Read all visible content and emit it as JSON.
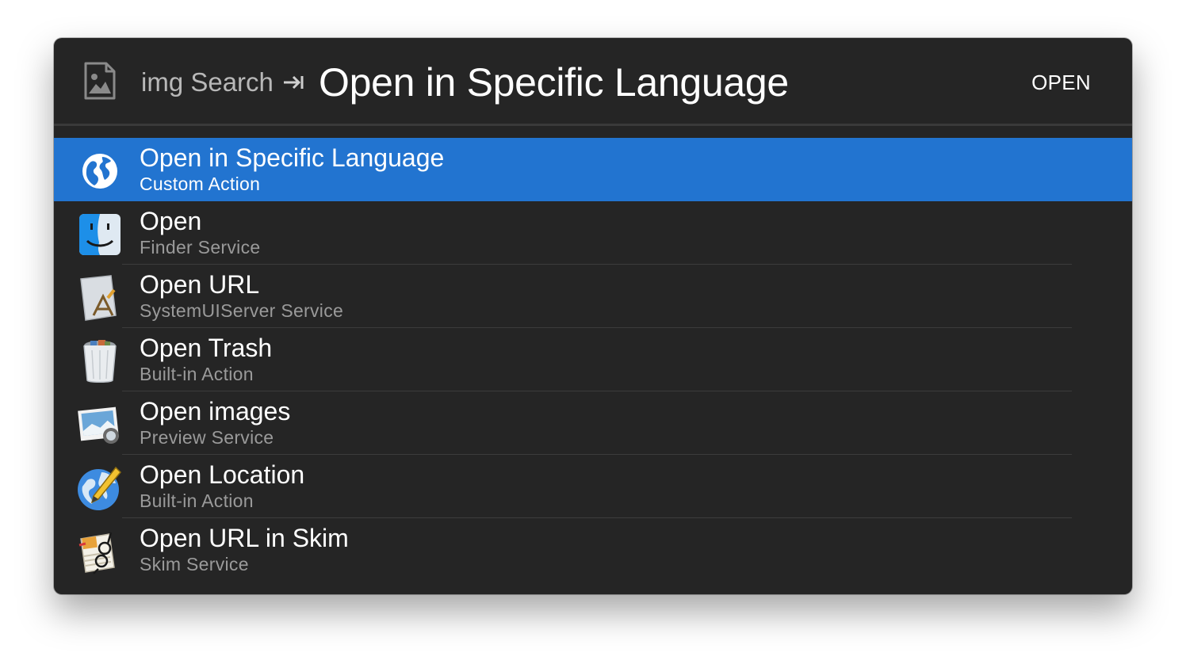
{
  "header": {
    "icon": "image-file-icon",
    "query": "img Search",
    "arrow_icon": "tab-arrow-icon",
    "action_title": "Open in Specific Language",
    "open_label": "OPEN"
  },
  "colors": {
    "window_bg": "#252525",
    "selected_bg": "#2274d0",
    "subtitle": "#9a9a9a"
  },
  "results": [
    {
      "title": "Open in Specific Language",
      "subtitle": "Custom Action",
      "icon": "globe-icon",
      "selected": true
    },
    {
      "title": "Open",
      "subtitle": "Finder Service",
      "icon": "finder-icon",
      "selected": false
    },
    {
      "title": "Open URL",
      "subtitle": "SystemUIServer Service",
      "icon": "app-document-icon",
      "selected": false
    },
    {
      "title": "Open Trash",
      "subtitle": "Built-in Action",
      "icon": "trash-icon",
      "selected": false
    },
    {
      "title": "Open images",
      "subtitle": "Preview Service",
      "icon": "preview-icon",
      "selected": false
    },
    {
      "title": "Open Location",
      "subtitle": "Built-in Action",
      "icon": "globe-pencil-icon",
      "selected": false
    },
    {
      "title": "Open URL in Skim",
      "subtitle": "Skim Service",
      "icon": "skim-icon",
      "selected": false
    }
  ]
}
